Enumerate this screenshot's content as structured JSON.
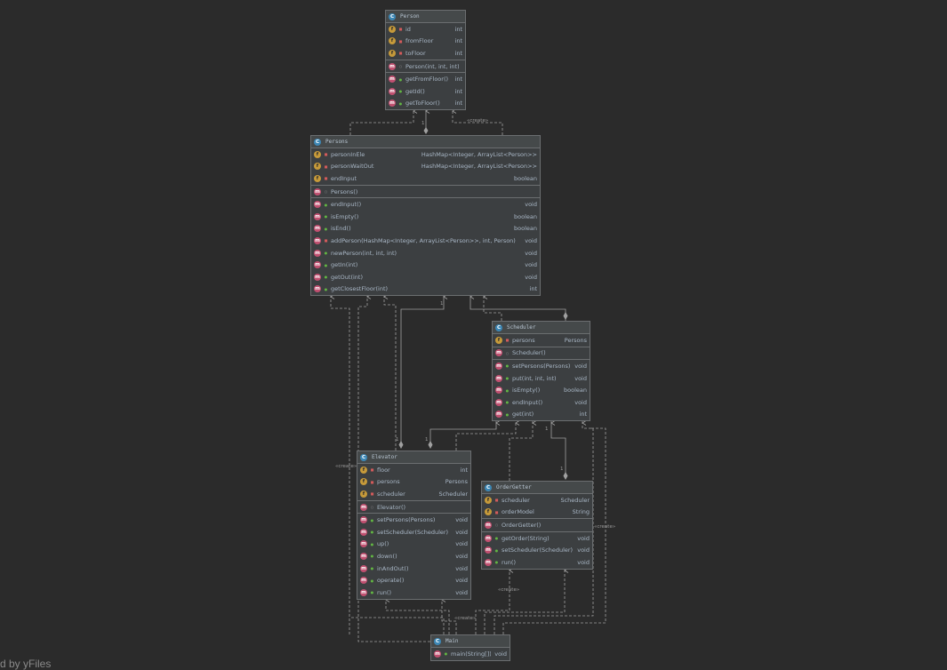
{
  "classes": {
    "person": {
      "name": "Person",
      "fields": [
        {
          "name": "id",
          "type": "int"
        },
        {
          "name": "fromFloor",
          "type": "int"
        },
        {
          "name": "toFloor",
          "type": "int"
        }
      ],
      "constructors": [
        {
          "name": "Person(int, int, int)",
          "type": ""
        }
      ],
      "methods": [
        {
          "name": "getFromFloor()",
          "type": "int"
        },
        {
          "name": "getId()",
          "type": "int"
        },
        {
          "name": "getToFloor()",
          "type": "int"
        }
      ]
    },
    "persons": {
      "name": "Persons",
      "fields": [
        {
          "name": "personInEle",
          "type": "HashMap<Integer, ArrayList<Person>>"
        },
        {
          "name": "personWaitOut",
          "type": "HashMap<Integer, ArrayList<Person>>"
        },
        {
          "name": "endInput",
          "type": "boolean"
        }
      ],
      "constructors": [
        {
          "name": "Persons()",
          "type": ""
        }
      ],
      "methods": [
        {
          "name": "endInput()",
          "type": "void"
        },
        {
          "name": "isEmpty()",
          "type": "boolean"
        },
        {
          "name": "isEnd()",
          "type": "boolean"
        },
        {
          "name": "addPerson(HashMap<Integer, ArrayList<Person>>, int, Person)",
          "type": "void"
        },
        {
          "name": "newPerson(int, int, int)",
          "type": "void"
        },
        {
          "name": "getIn(int)",
          "type": "void"
        },
        {
          "name": "getOut(int)",
          "type": "void"
        },
        {
          "name": "getClosestFloor(int)",
          "type": "int"
        }
      ]
    },
    "scheduler": {
      "name": "Scheduler",
      "fields": [
        {
          "name": "persons",
          "type": "Persons"
        }
      ],
      "constructors": [
        {
          "name": "Scheduler()",
          "type": ""
        }
      ],
      "methods": [
        {
          "name": "setPersons(Persons)",
          "type": "void"
        },
        {
          "name": "put(int, int, int)",
          "type": "void"
        },
        {
          "name": "isEmpty()",
          "type": "boolean"
        },
        {
          "name": "endInput()",
          "type": "void"
        },
        {
          "name": "get(int)",
          "type": "int"
        }
      ]
    },
    "elevator": {
      "name": "Elevator",
      "fields": [
        {
          "name": "floor",
          "type": "int"
        },
        {
          "name": "persons",
          "type": "Persons"
        },
        {
          "name": "scheduler",
          "type": "Scheduler"
        }
      ],
      "constructors": [
        {
          "name": "Elevator()",
          "type": ""
        }
      ],
      "methods": [
        {
          "name": "setPersons(Persons)",
          "type": "void"
        },
        {
          "name": "setScheduler(Scheduler)",
          "type": "void"
        },
        {
          "name": "up()",
          "type": "void"
        },
        {
          "name": "down()",
          "type": "void"
        },
        {
          "name": "inAndOut()",
          "type": "void"
        },
        {
          "name": "operate()",
          "type": "void"
        },
        {
          "name": "run()",
          "type": "void"
        }
      ]
    },
    "ordergetter": {
      "name": "OrderGetter",
      "fields": [
        {
          "name": "scheduler",
          "type": "Scheduler"
        },
        {
          "name": "orderModel",
          "type": "String"
        }
      ],
      "constructors": [
        {
          "name": "OrderGetter()",
          "type": ""
        }
      ],
      "methods": [
        {
          "name": "getOrder(String)",
          "type": "void"
        },
        {
          "name": "setScheduler(Scheduler)",
          "type": "void"
        },
        {
          "name": "run()",
          "type": "void"
        }
      ]
    },
    "main": {
      "name": "Main",
      "fields": [],
      "constructors": [],
      "methods": [
        {
          "name": "main(String[])",
          "type": "void"
        }
      ]
    }
  },
  "edge_labels": {
    "create": "«create»",
    "one": "1"
  },
  "icons": {
    "class": "class-icon",
    "field": "field-icon",
    "method": "method-icon"
  },
  "colors": {
    "background": "#2b2b2b",
    "node_fill": "#3c3f41",
    "border": "#6b6e70",
    "text": "#a9b7c6",
    "edge": "#a0a0a0",
    "field_icon": "#c69a3a",
    "method_icon": "#c05070",
    "class_icon": "#3d87b5"
  },
  "brand": "d by yFiles"
}
